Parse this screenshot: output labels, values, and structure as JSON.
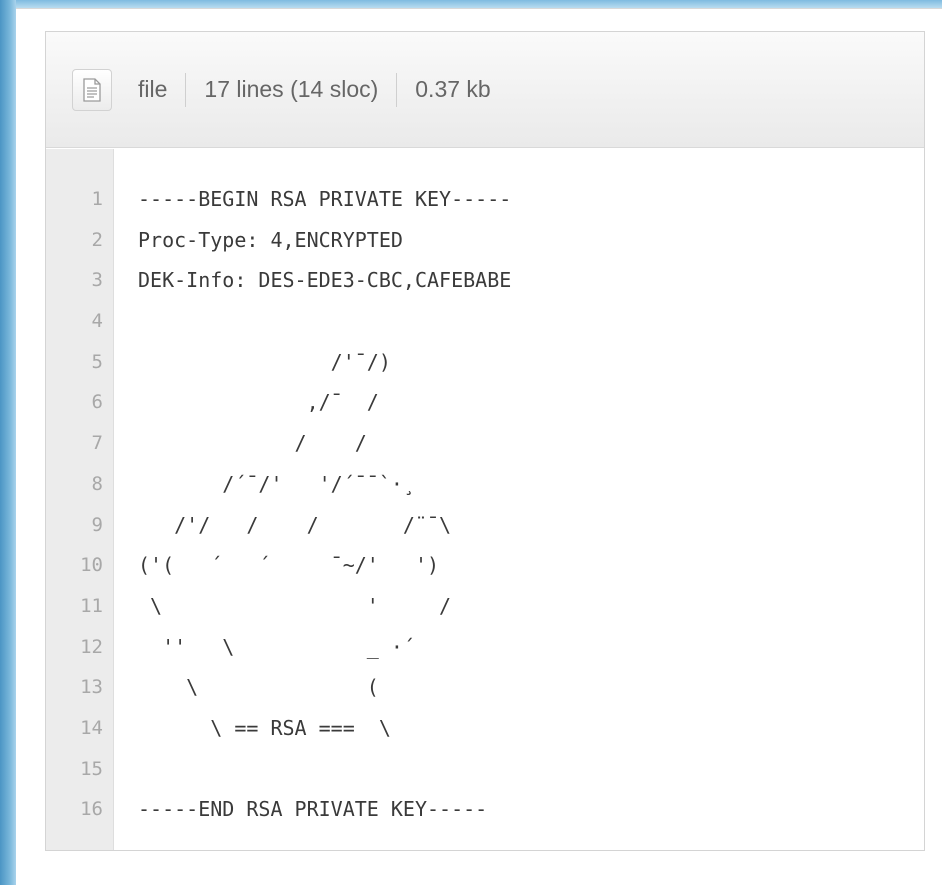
{
  "file_meta": {
    "mode": "file",
    "lines": "17 lines (14 sloc)",
    "size": "0.37 kb"
  },
  "code": {
    "line_numbers": [
      "1",
      "2",
      "3",
      "4",
      "5",
      "6",
      "7",
      "8",
      "9",
      "10",
      "11",
      "12",
      "13",
      "14",
      "15",
      "16"
    ],
    "lines": [
      "-----BEGIN RSA PRIVATE KEY-----",
      "Proc-Type: 4,ENCRYPTED",
      "DEK-Info: DES-EDE3-CBC,CAFEBABE",
      "",
      "                /'¯/)",
      "              ,/¯  /",
      "             /    /",
      "       /´¯/'   '/´¯¯`·¸",
      "   /'/   /    /       /¨¯\\",
      "('(   ´   ´     ¯~/'   ')",
      " \\                 '     /",
      "  ''   \\           _ ·´",
      "    \\              (",
      "      \\ == RSA ===  \\",
      "",
      "-----END RSA PRIVATE KEY-----"
    ]
  },
  "icons": {
    "file_icon": "file-text-icon"
  }
}
